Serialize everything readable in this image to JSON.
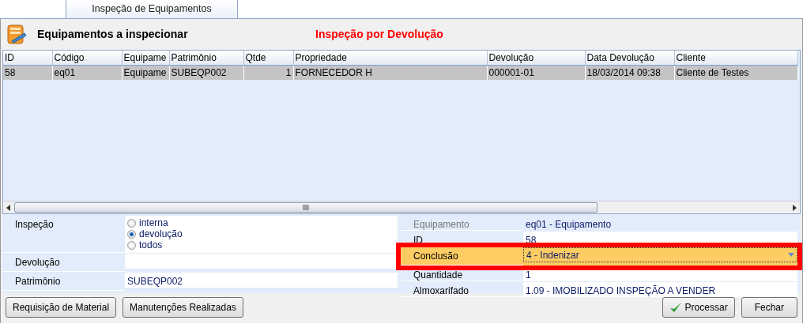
{
  "tab": {
    "label": "Inspeção de Equipamentos",
    "selected": true
  },
  "header": {
    "title": "Equipamentos a inspecionar",
    "mode": "Inspeção por Devolução"
  },
  "grid": {
    "columns": [
      "ID",
      "Código",
      "Equipame",
      "Patrimônio",
      "Qtde",
      "Propriedade",
      "Devolução",
      "Data Devolução",
      "Cliente"
    ],
    "rows": [
      {
        "cells": [
          "58",
          "eq01",
          "Equipame",
          "SUBEQP002",
          "1",
          "FORNECEDOR H",
          "000001-01",
          "18/03/2014 09:38",
          "Cliente de Testes"
        ],
        "selected": true
      }
    ]
  },
  "filters": [
    {
      "kind": "radio",
      "label": "Inspeção",
      "options": [
        {
          "label": "interna",
          "selected": false
        },
        {
          "label": "devolução",
          "selected": true
        },
        {
          "label": "todos",
          "selected": false
        }
      ]
    },
    {
      "kind": "text",
      "label": "Devolução"
    },
    {
      "kind": "text",
      "label": "Patrimônio",
      "value": "SUBEQP002"
    }
  ],
  "details": [
    {
      "kind": "readonly",
      "label": "Equipamento",
      "value": "eq01 - Equipamento"
    },
    {
      "kind": "text",
      "label": "ID",
      "value": "58"
    },
    {
      "kind": "dropdown",
      "label": "Conclusão",
      "value": "4 - Indenizar",
      "highlighted": true
    },
    {
      "kind": "text",
      "label": "Quantidade",
      "value": "1"
    },
    {
      "kind": "text",
      "label": "Almoxarifado",
      "value": "1.09 - IMOBILIZADO INSPEÇÃO A VENDER"
    }
  ],
  "buttons_left": [
    {
      "label": "Requisição de Material"
    },
    {
      "label": "Manutenções Realizadas"
    }
  ],
  "buttons_right": [
    {
      "label": "Processar",
      "kind": "confirm"
    },
    {
      "label": "Fechar",
      "kind": "plain"
    }
  ]
}
